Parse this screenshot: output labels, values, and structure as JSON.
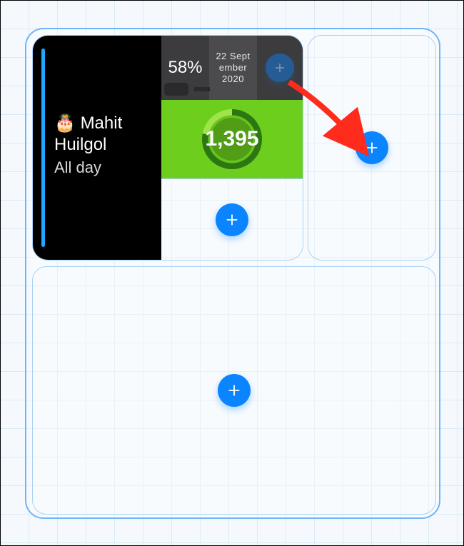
{
  "calendar": {
    "icon": "🎂",
    "title": "Mahit Huilgol",
    "subtitle": "All day"
  },
  "battery": {
    "percent_label": "58%"
  },
  "date": {
    "text": "22 Sept ember 2020"
  },
  "steps": {
    "value": "1,395"
  },
  "icons": {
    "plus": "plus-icon"
  }
}
